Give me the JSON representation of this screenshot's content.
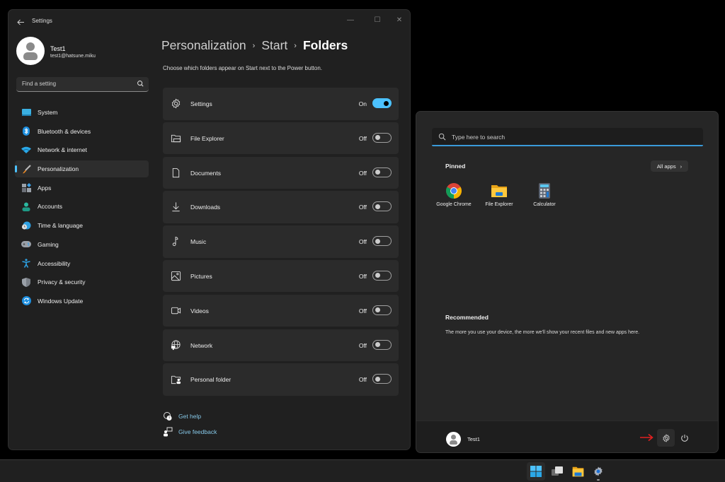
{
  "settings_window": {
    "title": "Settings",
    "back_icon": "back-arrow-icon",
    "window_controls": {
      "minimize": "—",
      "maximize": "☐",
      "close": "✕"
    },
    "user": {
      "name": "Test1",
      "email": "test1@hatsune.miku"
    },
    "search": {
      "placeholder": "Find a setting",
      "icon": "search-icon"
    },
    "nav": [
      {
        "label": "System",
        "icon": "system-icon",
        "active": false
      },
      {
        "label": "Bluetooth & devices",
        "icon": "bluetooth-icon",
        "active": false
      },
      {
        "label": "Network & internet",
        "icon": "wifi-icon",
        "active": false
      },
      {
        "label": "Personalization",
        "icon": "paintbrush-icon",
        "active": true
      },
      {
        "label": "Apps",
        "icon": "apps-icon",
        "active": false
      },
      {
        "label": "Accounts",
        "icon": "accounts-icon",
        "active": false
      },
      {
        "label": "Time & language",
        "icon": "time-language-icon",
        "active": false
      },
      {
        "label": "Gaming",
        "icon": "gamepad-icon",
        "active": false
      },
      {
        "label": "Accessibility",
        "icon": "accessibility-icon",
        "active": false
      },
      {
        "label": "Privacy & security",
        "icon": "shield-icon",
        "active": false
      },
      {
        "label": "Windows Update",
        "icon": "update-icon",
        "active": false
      }
    ],
    "breadcrumb": [
      "Personalization",
      "Start",
      "Folders"
    ],
    "breadcrumb_sep": "›",
    "description": "Choose which folders appear on Start next to the Power button.",
    "folders": [
      {
        "label": "Settings",
        "icon": "gear-icon",
        "state": "On",
        "on": true
      },
      {
        "label": "File Explorer",
        "icon": "file-explorer-icon",
        "state": "Off",
        "on": false
      },
      {
        "label": "Documents",
        "icon": "document-icon",
        "state": "Off",
        "on": false
      },
      {
        "label": "Downloads",
        "icon": "download-icon",
        "state": "Off",
        "on": false
      },
      {
        "label": "Music",
        "icon": "music-note-icon",
        "state": "Off",
        "on": false
      },
      {
        "label": "Pictures",
        "icon": "picture-icon",
        "state": "Off",
        "on": false
      },
      {
        "label": "Videos",
        "icon": "video-icon",
        "state": "Off",
        "on": false
      },
      {
        "label": "Network",
        "icon": "network-globe-icon",
        "state": "Off",
        "on": false
      },
      {
        "label": "Personal folder",
        "icon": "personal-folder-icon",
        "state": "Off",
        "on": false
      }
    ],
    "help_links": [
      {
        "label": "Get help",
        "icon": "help-icon"
      },
      {
        "label": "Give feedback",
        "icon": "feedback-icon"
      }
    ]
  },
  "start_menu": {
    "search_placeholder": "Type here to search",
    "pinned_title": "Pinned",
    "all_apps_label": "All apps",
    "all_apps_chevron": "›",
    "pinned_apps": [
      {
        "label": "Google Chrome",
        "icon": "chrome-icon"
      },
      {
        "label": "File Explorer",
        "icon": "file-explorer-icon"
      },
      {
        "label": "Calculator",
        "icon": "calculator-icon"
      }
    ],
    "recommended_title": "Recommended",
    "recommended_desc": "The more you use your device, the more we'll show your recent files and new apps here.",
    "footer": {
      "user_name": "Test1",
      "settings_icon": "gear-icon",
      "power_icon": "power-icon",
      "annotation": "red-arrow-pointing-to-settings"
    }
  },
  "taskbar": {
    "items": [
      {
        "name": "start",
        "icon": "windows-logo-icon",
        "active": true
      },
      {
        "name": "task-view",
        "icon": "task-view-icon",
        "active": false
      },
      {
        "name": "file-explorer",
        "icon": "file-explorer-icon",
        "active": false
      },
      {
        "name": "settings",
        "icon": "gear-icon",
        "active": false,
        "running": true
      }
    ]
  },
  "colors": {
    "accent": "#4cc2ff",
    "link": "#86c8e8",
    "window_bg": "#202020",
    "card_bg": "#2b2b2b",
    "annotation_arrow": "#e02020"
  }
}
